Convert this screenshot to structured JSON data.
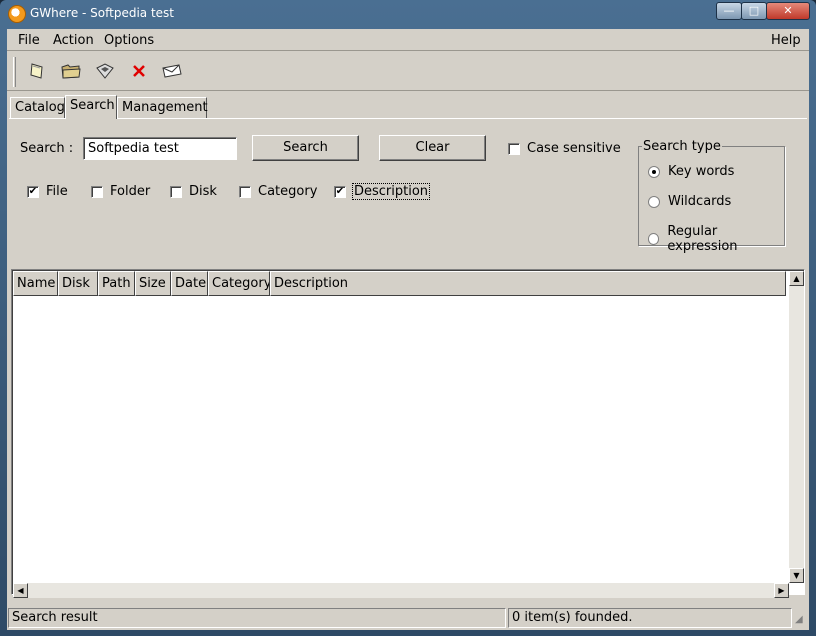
{
  "window": {
    "title": "GWhere - Softpedia test",
    "minimize": "—",
    "maximize": "□",
    "close": "✕"
  },
  "menu": {
    "file": "File",
    "action": "Action",
    "options": "Options",
    "help": "Help"
  },
  "toolbar": {
    "icons": [
      "new-catalog-icon",
      "open-folder-icon",
      "save-disk-icon",
      "delete-icon",
      "mail-icon"
    ]
  },
  "tabs": {
    "catalog": "Catalog",
    "search": "Search",
    "management": "Management"
  },
  "search": {
    "label": "Search :",
    "value": "Softpedia test",
    "search_button": "Search",
    "clear_button": "Clear",
    "case_sensitive": {
      "label": "Case sensitive",
      "checked": false
    },
    "filters": [
      {
        "label": "File",
        "checked": true
      },
      {
        "label": "Folder",
        "checked": false
      },
      {
        "label": "Disk",
        "checked": false
      },
      {
        "label": "Category",
        "checked": false
      },
      {
        "label": "Description",
        "checked": true
      }
    ],
    "type": {
      "legend": "Search type",
      "options": [
        {
          "label": "Key words",
          "selected": true
        },
        {
          "label": "Wildcards",
          "selected": false
        },
        {
          "label": "Regular expression",
          "selected": false
        }
      ]
    }
  },
  "results": {
    "columns": [
      "Name",
      "Disk",
      "Path",
      "Size",
      "Date",
      "Category",
      "Description"
    ],
    "rows": []
  },
  "status": {
    "left": "Search result",
    "right": "0 item(s) founded."
  },
  "colors": {
    "face": "#d4d0c8",
    "title_bar": "#3d6386"
  }
}
